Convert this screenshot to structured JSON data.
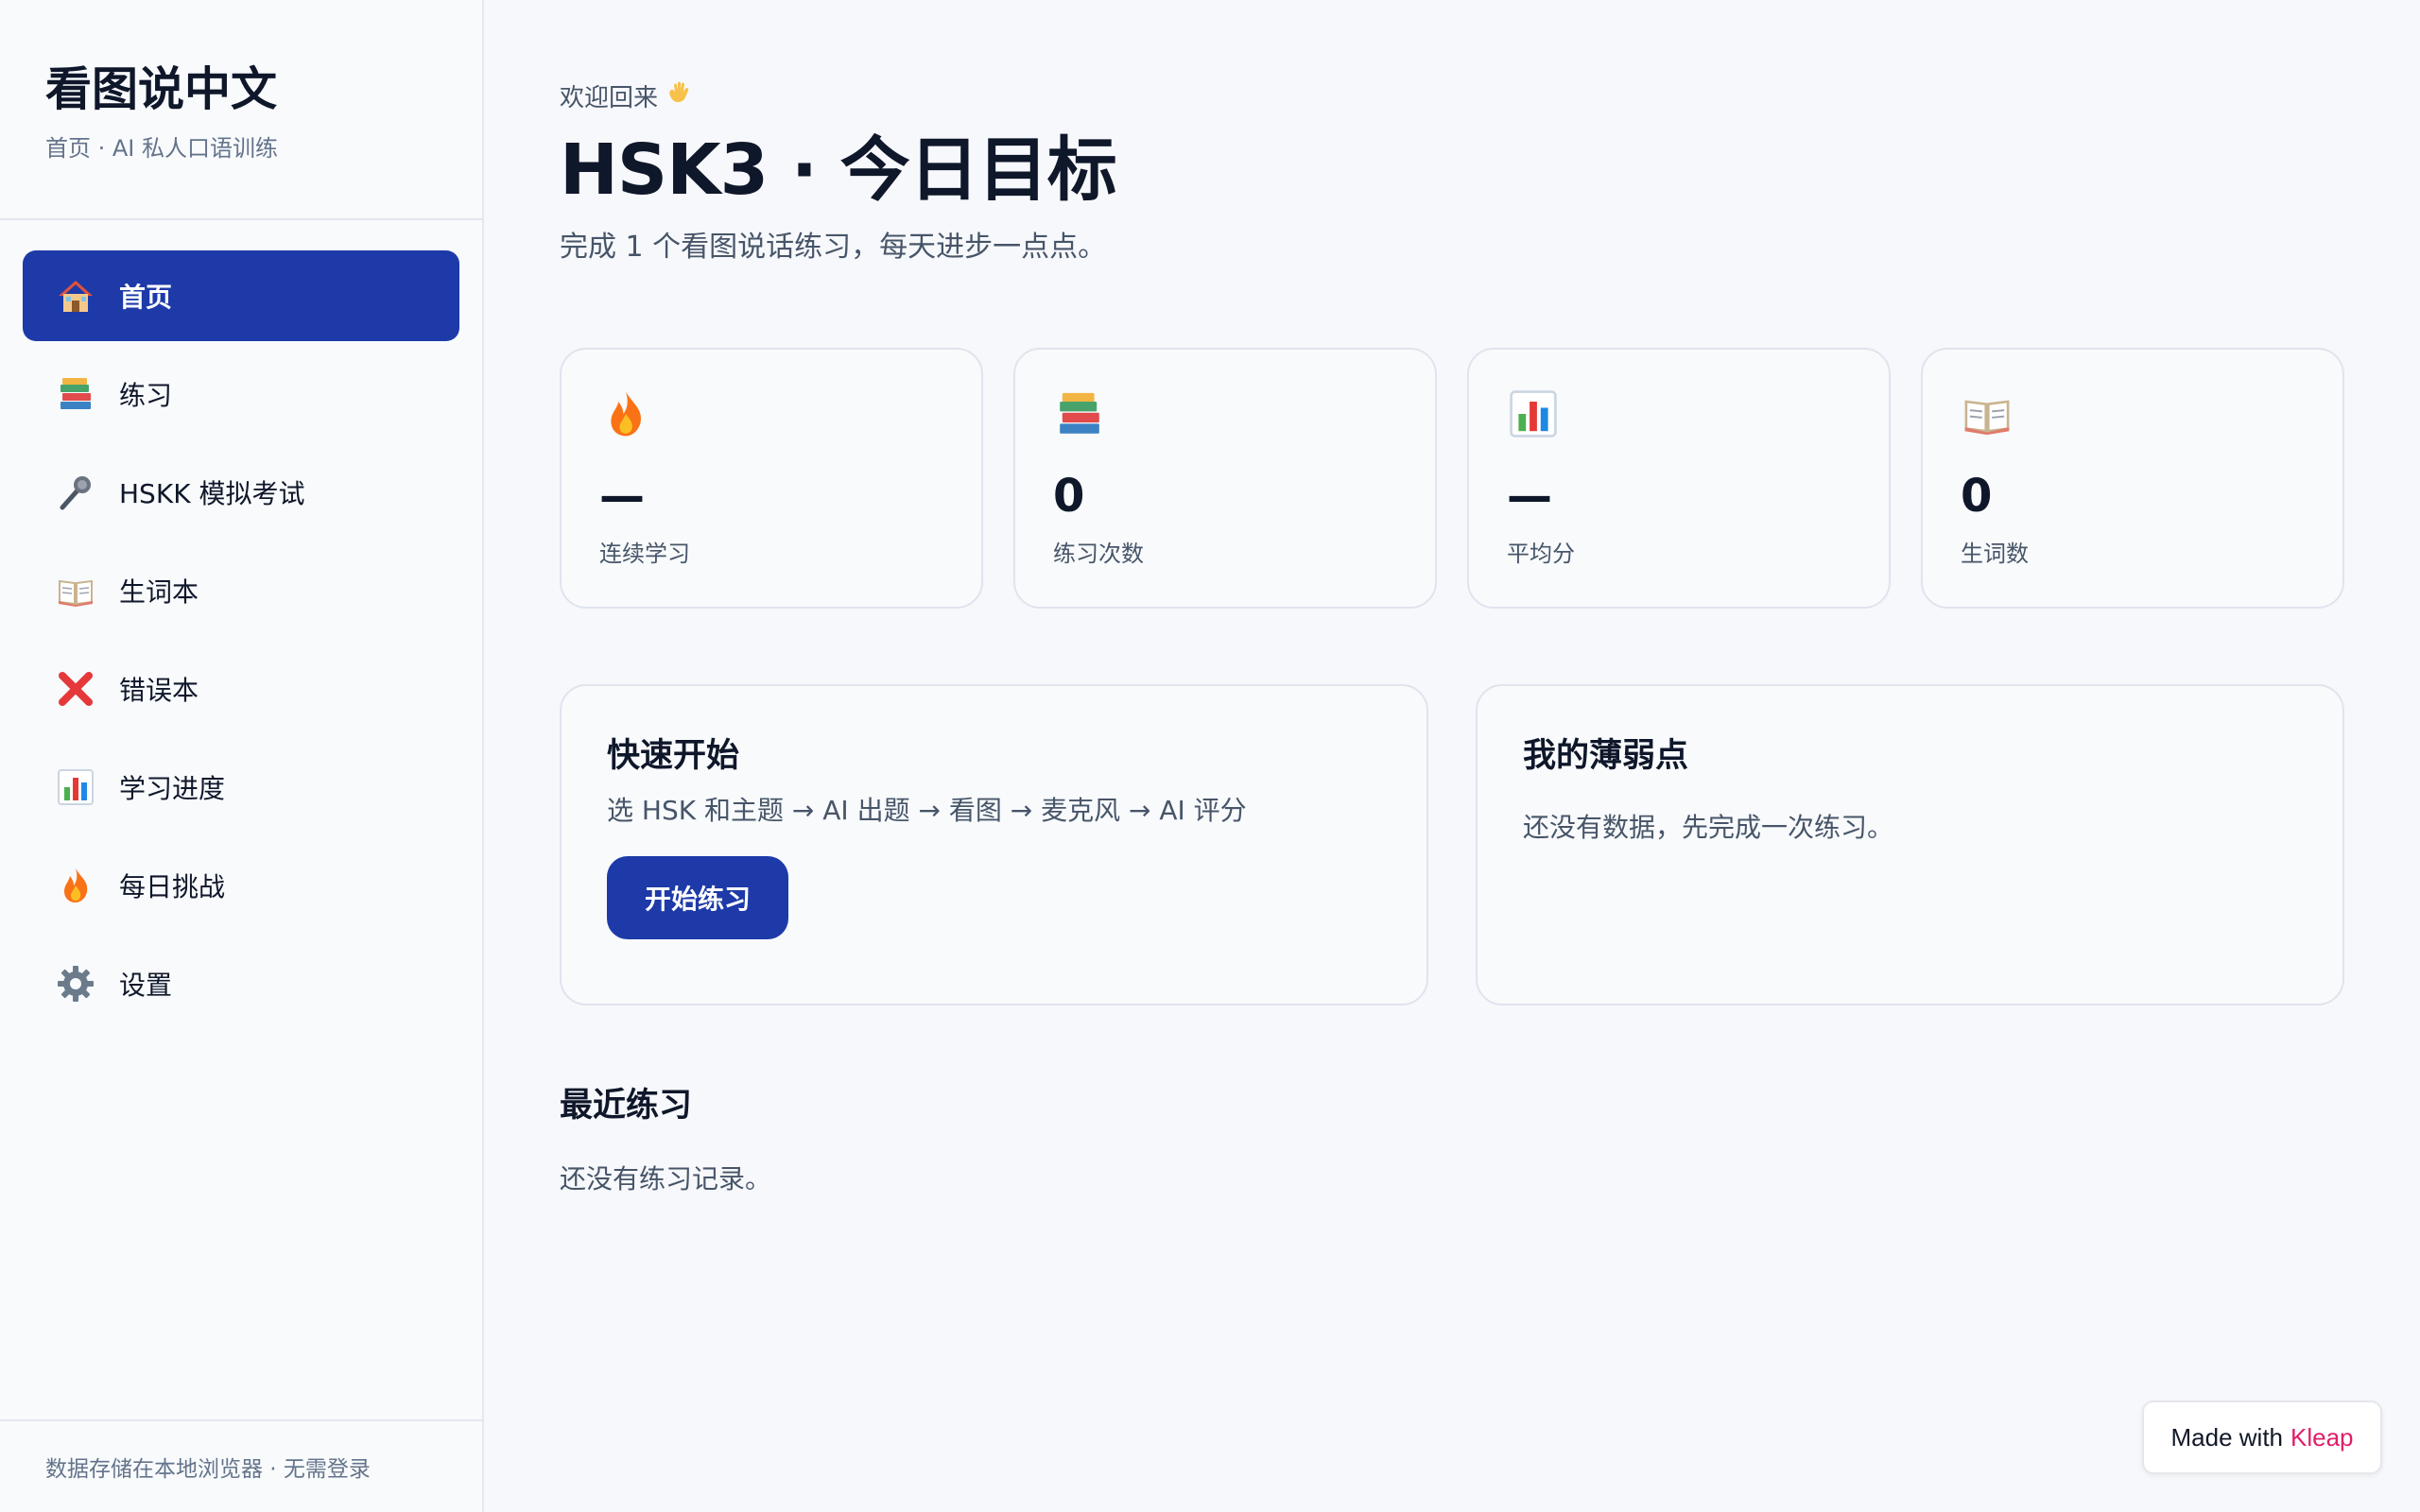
{
  "sidebar": {
    "title": "看图说中文",
    "subtitle": "首页 · AI 私人口语训练",
    "items": [
      {
        "label": "首页",
        "icon": "house-icon",
        "active": true
      },
      {
        "label": "练习",
        "icon": "books-icon",
        "active": false
      },
      {
        "label": "HSKK 模拟考试",
        "icon": "microphone-icon",
        "active": false
      },
      {
        "label": "生词本",
        "icon": "open-book-icon",
        "active": false
      },
      {
        "label": "错误本",
        "icon": "cross-mark-icon",
        "active": false
      },
      {
        "label": "学习进度",
        "icon": "bar-chart-icon",
        "active": false
      },
      {
        "label": "每日挑战",
        "icon": "fire-icon",
        "active": false
      },
      {
        "label": "设置",
        "icon": "gear-icon",
        "active": false
      }
    ],
    "footer": "数据存储在本地浏览器 · 无需登录"
  },
  "main": {
    "welcome": "欢迎回来",
    "title": "HSK3 · 今日目标",
    "subtitle": "完成 1 个看图说话练习，每天进步一点点。",
    "stats": [
      {
        "icon": "fire-icon",
        "value": "—",
        "label": "连续学习"
      },
      {
        "icon": "books-icon",
        "value": "0",
        "label": "练习次数"
      },
      {
        "icon": "bar-chart-icon",
        "value": "—",
        "label": "平均分"
      },
      {
        "icon": "open-book-icon",
        "value": "0",
        "label": "生词数"
      }
    ],
    "quick_start": {
      "title": "快速开始",
      "text": "选 HSK 和主题 → AI 出题 → 看图 → 麦克风 → AI 评分",
      "button": "开始练习"
    },
    "weak_points": {
      "title": "我的薄弱点",
      "empty": "还没有数据，先完成一次练习。"
    },
    "recent": {
      "title": "最近练习",
      "empty": "还没有练习记录。"
    }
  },
  "badge": {
    "prefix": "Made with",
    "brand": "Kleap"
  },
  "colors": {
    "accent": "#1d3aa8",
    "brand_pink": "#e11d6a",
    "background": "#f7f8fb"
  }
}
